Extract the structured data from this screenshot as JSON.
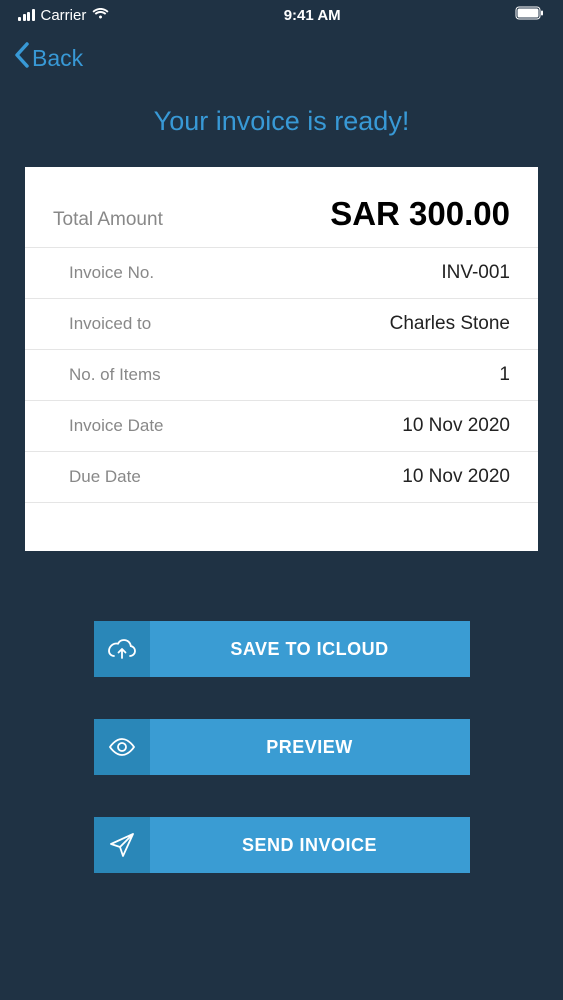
{
  "status_bar": {
    "carrier": "Carrier",
    "time": "9:41 AM"
  },
  "header": {
    "back_label": "Back"
  },
  "page": {
    "title": "Your invoice is ready!"
  },
  "invoice": {
    "total_label": "Total Amount",
    "total_amount": "SAR 300.00",
    "fields": [
      {
        "label": "Invoice No.",
        "value": "INV-001"
      },
      {
        "label": "Invoiced to",
        "value": "Charles Stone"
      },
      {
        "label": "No. of Items",
        "value": "1"
      },
      {
        "label": "Invoice Date",
        "value": "10 Nov 2020"
      },
      {
        "label": "Due Date",
        "value": "10 Nov 2020"
      }
    ]
  },
  "actions": {
    "save_label": "SAVE TO ICLOUD",
    "preview_label": "PREVIEW",
    "send_label": "SEND INVOICE"
  }
}
